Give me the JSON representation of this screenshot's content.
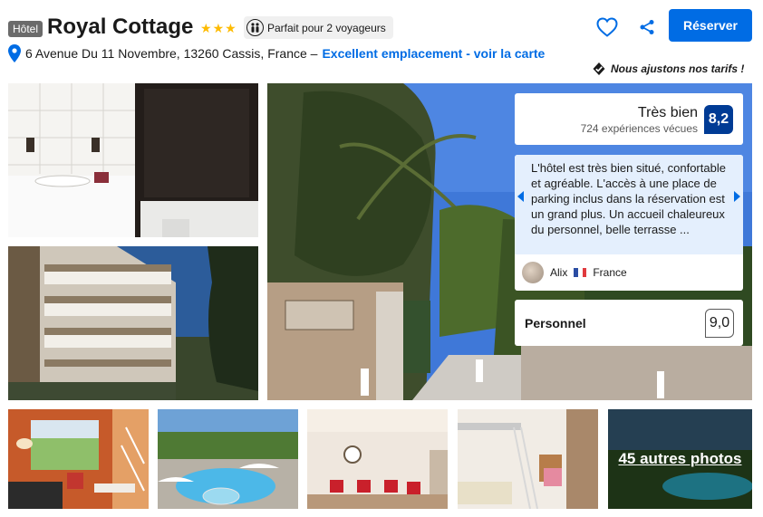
{
  "header": {
    "property_type": "Hôtel",
    "name": "Royal Cottage",
    "stars": 3,
    "badge_label": "Parfait pour 2 voyageurs",
    "address": "6 Avenue Du 11 Novembre, 13260 Cassis, France –",
    "location_link": "Excellent emplacement - voir la carte",
    "reserve_label": "Réserver",
    "price_note": "Nous ajustons nos tarifs !"
  },
  "review_overlay": {
    "score_label": "Très bien",
    "review_count": "724 expériences vécues",
    "score": "8,2",
    "quote": "L'hôtel est très bien situé, confortable et agréable. L'accès à une place de parking inclus dans la réservation est un grand plus. Un accueil chaleureux du personnel, belle terrasse ...",
    "reviewer_name": "Alix",
    "reviewer_country": "France",
    "category_label": "Personnel",
    "category_score": "9,0"
  },
  "gallery": {
    "more_photos_label": "45 autres photos"
  },
  "colors": {
    "brand_blue": "#006ce4",
    "score_dark_blue": "#003b95",
    "star_yellow": "#febb02",
    "review_bg": "#e4effd"
  },
  "icons": {
    "favorite": "heart-icon",
    "share": "share-icon",
    "location": "map-pin-icon",
    "price_note": "shield-check-icon",
    "travelers": "two-people-icon"
  }
}
